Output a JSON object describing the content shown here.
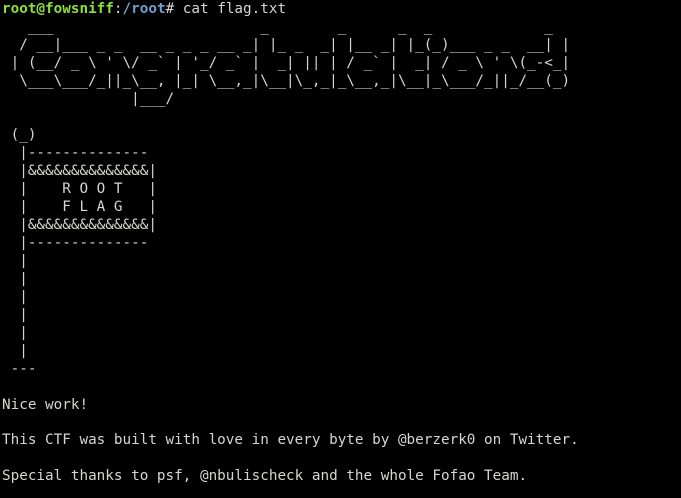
{
  "prompt": {
    "user_host": "root@fowsniff",
    "separator": ":",
    "path": "/root",
    "symbol": "# ",
    "command": "cat flag.txt"
  },
  "colors": {
    "background": "#000000",
    "text": "#d3d7cf",
    "prompt_user": "#8ae234",
    "prompt_path": "#729fcf"
  },
  "banner_lines": [
    "   ___                        _        _      _  _             _ ",
    "  / __|___ _ _  __ _ _ _ __ _| |_ _  _| |__ _| |_(_)___ _ _  __| |",
    " | (__/ _ \\ ' \\/ _` | '_/ _` |  _| || | / _` |  _| / _ \\ ' \\(_-<_|",
    "  \\___\\___/_||_\\__, |_| \\__,_|\\__|\\_,_|_\\__,_|\\__|_\\___/_||_/__(_)",
    "               |___/ "
  ],
  "flag_lines": [
    " (_)",
    "  |--------------",
    "  |&&&&&&&&&&&&&&|",
    "  |    R O O T   |",
    "  |    F L A G   |",
    "  |&&&&&&&&&&&&&&|",
    "  |--------------",
    "  |",
    "  |",
    "  |",
    "  |",
    "  |",
    "  |",
    "  |",
    " ---"
  ],
  "messages": {
    "nice_work": "Nice work!",
    "credits": "This CTF was built with love in every byte by @berzerk0 on Twitter.",
    "thanks": "Special thanks to psf, @nbulischeck and the whole Fofao Team."
  }
}
